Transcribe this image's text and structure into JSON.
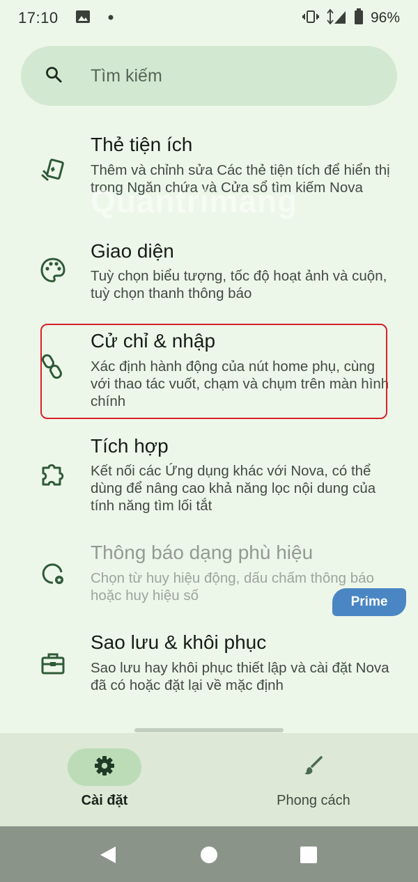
{
  "status_bar": {
    "time": "17:10",
    "battery": "96%"
  },
  "search": {
    "placeholder": "Tìm kiếm"
  },
  "settings": [
    {
      "title": "Thẻ tiện ích",
      "description": "Thêm và chỉnh sửa Các thẻ tiện tích để hiển thị trong Ngăn chứa và Cửa sổ tìm kiếm Nova",
      "icon": "widget-cards-icon"
    },
    {
      "title": "Giao diện",
      "description": "Tuỳ chọn biểu tượng, tốc độ hoạt ảnh và cuộn, tuỳ chọn thanh thông báo",
      "icon": "palette-icon"
    },
    {
      "title": "Cử chỉ & nhập",
      "description": "Xác định hành động của nút home phụ, cùng với thao tác vuốt, chạm và chụm trên màn hình chính",
      "icon": "gesture-icon"
    },
    {
      "title": "Tích hợp",
      "description": "Kết nối các Ứng dụng khác với Nova, có thể dùng để nâng cao khả năng lọc nội dung của tính năng tìm lối tắt",
      "icon": "puzzle-icon"
    },
    {
      "title": "Thông báo dạng phù hiệu",
      "description": "Chọn từ huy hiệu động, dấu chấm thông báo hoặc huy hiệu số",
      "icon": "badge-icon",
      "badge": "Prime"
    },
    {
      "title": "Sao lưu & khôi phục",
      "description": "Sao lưu hay khôi phục thiết lập và cài đặt Nova đã có hoặc đặt lại về mặc định",
      "icon": "briefcase-icon"
    }
  ],
  "watermark": "Quantrimang",
  "bottom_nav": {
    "items": [
      {
        "label": "Cài đặt",
        "icon": "gear-icon",
        "active": true
      },
      {
        "label": "Phong cách",
        "icon": "brush-icon",
        "active": false
      }
    ]
  },
  "colors": {
    "background": "#edf7e9",
    "search_bg": "#d3e8d0",
    "accent_icon": "#2e5a38",
    "highlight": "#d8202a",
    "prime": "#4a86c3"
  }
}
